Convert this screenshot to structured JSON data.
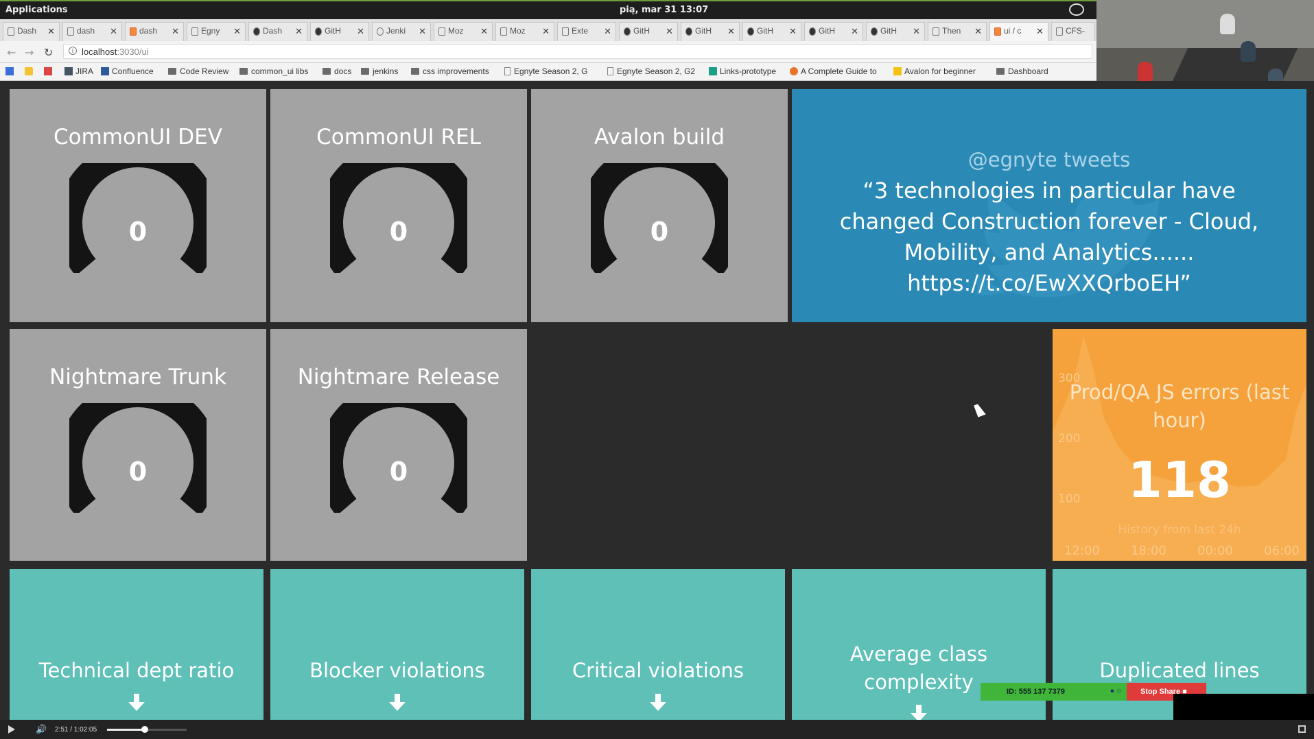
{
  "os": {
    "apps_label": "Applications",
    "clock": "pią, mar 31    13:07"
  },
  "browser": {
    "tabs": [
      "Dash",
      "dash",
      "dash",
      "Egny",
      "Dash",
      "GitH",
      "Jenki",
      "Moz",
      "Moz",
      "Exte",
      "GitH",
      "GitH",
      "GitH",
      "GitH",
      "GitH",
      "Then",
      "ui / c",
      "CFS-"
    ],
    "url_host": "localhost",
    "url_path": ":3030/ui",
    "bookmarks": [
      "JIRA",
      "Confluence",
      "Code Review",
      "common_ui libs",
      "docs",
      "jenkins",
      "css improvements",
      "Egnyte Season 2, G",
      "Egnyte Season 2, G2",
      "Links-prototype",
      "A Complete Guide to",
      "Avalon for beginner",
      "Dashboard"
    ]
  },
  "gauges": [
    {
      "title": "CommonUI DEV",
      "value": "0"
    },
    {
      "title": "CommonUI REL",
      "value": "0"
    },
    {
      "title": "Avalon build",
      "value": "0"
    },
    {
      "title": "Nightmare Trunk",
      "value": "0"
    },
    {
      "title": "Nightmare Release",
      "value": "0"
    }
  ],
  "tweet": {
    "handle": "@egnyte tweets",
    "text": "“3 technologies in particular have changed Construction forever - Cloud, Mobility, and Analytics...... https://t.co/EwXXQrboEH”"
  },
  "errors": {
    "title": "Prod/QA JS errors (last hour)",
    "value": "118",
    "history_label": "History from last 24h",
    "y_ticks": [
      "300",
      "200",
      "100"
    ],
    "x_ticks": [
      "12:00",
      "18:00",
      "00:00",
      "06:00"
    ]
  },
  "sonar": [
    {
      "title": "Technical dept ratio"
    },
    {
      "title": "Blocker violations"
    },
    {
      "title": "Critical violations"
    },
    {
      "title": "Average class complexity"
    },
    {
      "title": "Duplicated lines"
    }
  ],
  "share": {
    "id_label": "ID: 555 137 7379",
    "stop_label": "Stop Share"
  },
  "player": {
    "time": "2:51 / 1:02:05",
    "progress": 0.0455
  },
  "colors": {
    "gauge": "#a3a3a3",
    "tweet": "#2a8ab5",
    "errors": "#f5a23c",
    "sonar": "#5ec0b6",
    "background": "#2b2b2b"
  }
}
